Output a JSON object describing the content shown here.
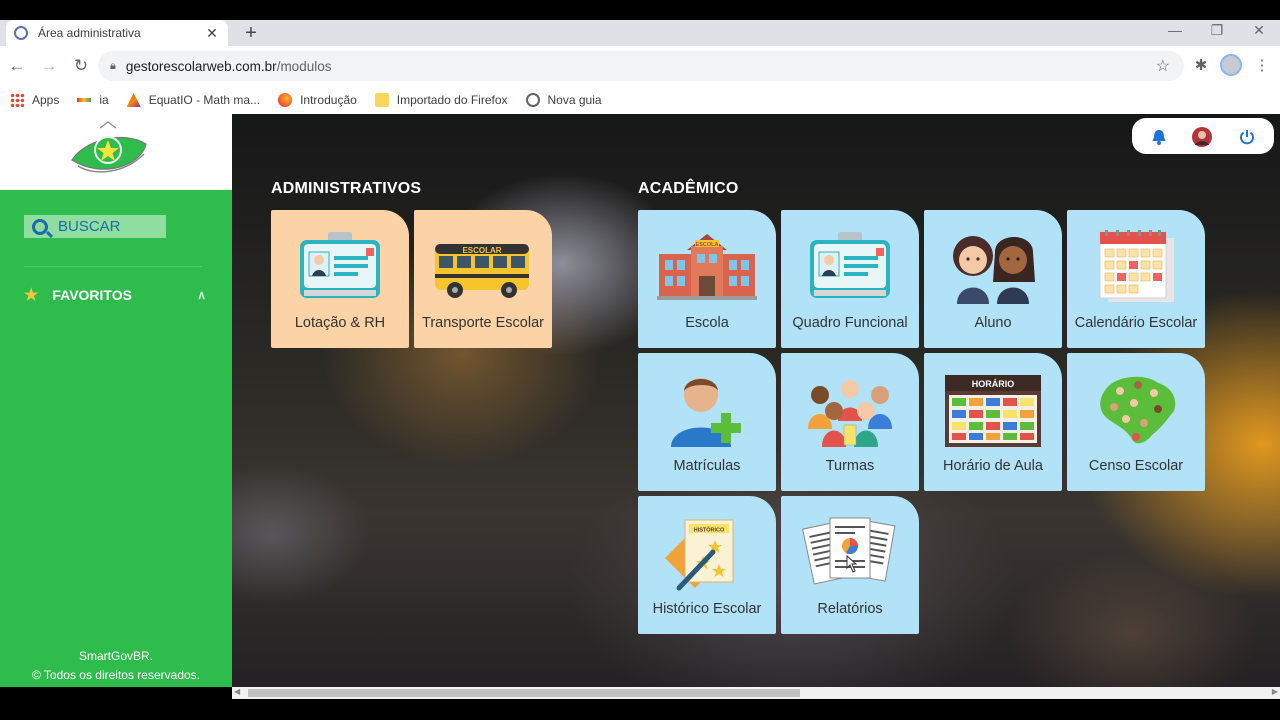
{
  "browser": {
    "tab_title": "Área administrativa",
    "tab_close": "✕",
    "new_tab": "+",
    "url_domain": "gestorescolarweb.com.br",
    "url_path": "/modulos",
    "bookmarks": [
      {
        "label": "Apps",
        "icon": "apps-grid-icon"
      },
      {
        "label": "ia",
        "icon": "ia-icon"
      },
      {
        "label": "EquatIO - Math ma...",
        "icon": "equatio-icon"
      },
      {
        "label": "Introdução",
        "icon": "firefox-icon"
      },
      {
        "label": "Importado do Firefox",
        "icon": "folder-icon"
      },
      {
        "label": "Nova guia",
        "icon": "globe-icon"
      }
    ]
  },
  "sidebar": {
    "search_label": "BUSCAR",
    "favorites_label": "FAVORITOS",
    "footer_line1": "SmartGovBR.",
    "footer_line2": "© Todos os direitos reservados."
  },
  "sections": {
    "admin_title": "ADMINISTRATIVOS",
    "academic_title": "ACADÊMICO"
  },
  "admin_modules": [
    {
      "label": "Lotação & RH",
      "icon": "id-card-icon"
    },
    {
      "label": "Transporte Escolar",
      "icon": "school-bus-icon"
    }
  ],
  "academic_modules": [
    {
      "label": "Escola",
      "icon": "school-building-icon"
    },
    {
      "label": "Quadro Funcional",
      "icon": "id-card-icon"
    },
    {
      "label": "Aluno",
      "icon": "students-icon"
    },
    {
      "label": "Calendário Escolar",
      "icon": "calendar-icon"
    },
    {
      "label": "Matrículas",
      "icon": "add-user-icon"
    },
    {
      "label": "Turmas",
      "icon": "class-group-icon"
    },
    {
      "label": "Horário de Aula",
      "icon": "timetable-icon"
    },
    {
      "label": "Censo Escolar",
      "icon": "census-map-icon"
    },
    {
      "label": "Histórico Escolar",
      "icon": "history-document-icon"
    },
    {
      "label": "Relatórios",
      "icon": "reports-icon"
    }
  ],
  "icon_texts": {
    "bus_sign": "ESCOLAR",
    "school_sign": "ESCOLA",
    "timetable_sign": "HORÁRIO",
    "history_sign": "HISTÓRICO"
  },
  "colors": {
    "sidebar_green": "#2ebd4c",
    "admin_card": "#fbd3a6",
    "academic_card": "#b1e2f8",
    "search_blue": "#1d6ab0",
    "bell_blue": "#1e73d8"
  }
}
